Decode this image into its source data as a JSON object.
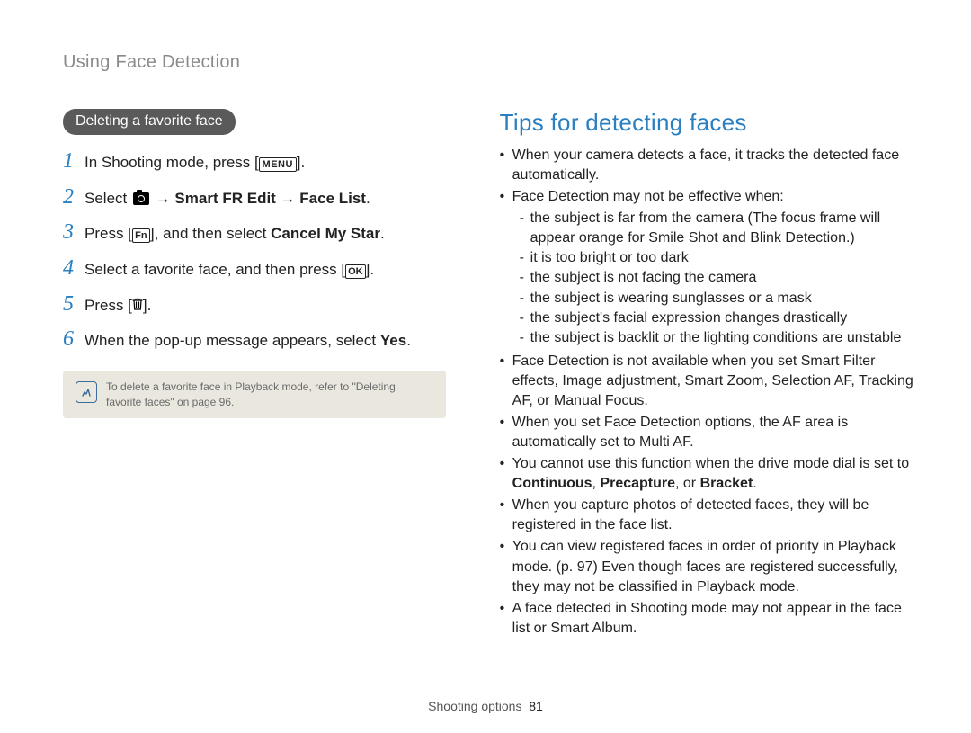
{
  "breadcrumb": "Using Face Detection",
  "section_pill": "Deleting a favorite face",
  "steps": [
    {
      "pre": "In Shooting mode, press [",
      "icon": "menu",
      "post": "]."
    },
    {
      "pre": "Select ",
      "icon": "camera",
      "post_bold": " → Smart FR Edit → Face List",
      "post_plain": "."
    },
    {
      "pre": "Press [",
      "icon": "fn",
      "mid": "], and then select ",
      "bold": "Cancel My Star",
      "post_plain": "."
    },
    {
      "pre": "Select a favorite face, and then press [",
      "icon": "ok",
      "post": "]."
    },
    {
      "pre": "Press [",
      "icon": "trash",
      "post": "]."
    },
    {
      "pre": "When the pop-up message appears, select ",
      "bold": "Yes",
      "post_plain": "."
    }
  ],
  "note_text": "To delete a favorite face in Playback mode, refer to \"Deleting favorite faces\" on page 96.",
  "tips_title": "Tips for detecting faces",
  "tips": [
    {
      "text": "When your camera detects a face, it tracks the detected face automatically."
    },
    {
      "text": "Face Detection may not be effective when:",
      "sub": [
        "the subject is far from the camera (The focus frame will appear orange for Smile Shot and Blink Detection.)",
        "it is too bright or too dark",
        "the subject is not facing the camera",
        "the subject is wearing sunglasses or a mask",
        "the subject's facial expression changes drastically",
        "the subject is backlit or the lighting conditions are unstable"
      ]
    },
    {
      "text": "Face Detection is not available when you set Smart Filter effects, Image adjustment, Smart Zoom, Selection AF, Tracking AF, or Manual Focus."
    },
    {
      "text": "When you set Face Detection options, the AF area is automatically set to Multi AF."
    },
    {
      "text_pre": "You cannot use this function when the drive mode dial is set to ",
      "bold": "Continuous",
      "mid": ", ",
      "bold2": "Precapture",
      "mid2": ", or ",
      "bold3": "Bracket",
      "post": "."
    },
    {
      "text": "When you capture photos of detected faces, they will be registered in the face list."
    },
    {
      "text": "You can view registered faces in order of priority in Playback mode. (p. 97) Even though faces are registered successfully, they may not be classified in Playback mode."
    },
    {
      "text": "A face detected in Shooting mode may not appear in the face list or Smart Album."
    }
  ],
  "footer_label": "Shooting options",
  "footer_page": "81",
  "icon_labels": {
    "menu": "MENU",
    "fn": "Fn",
    "ok": "OK"
  }
}
